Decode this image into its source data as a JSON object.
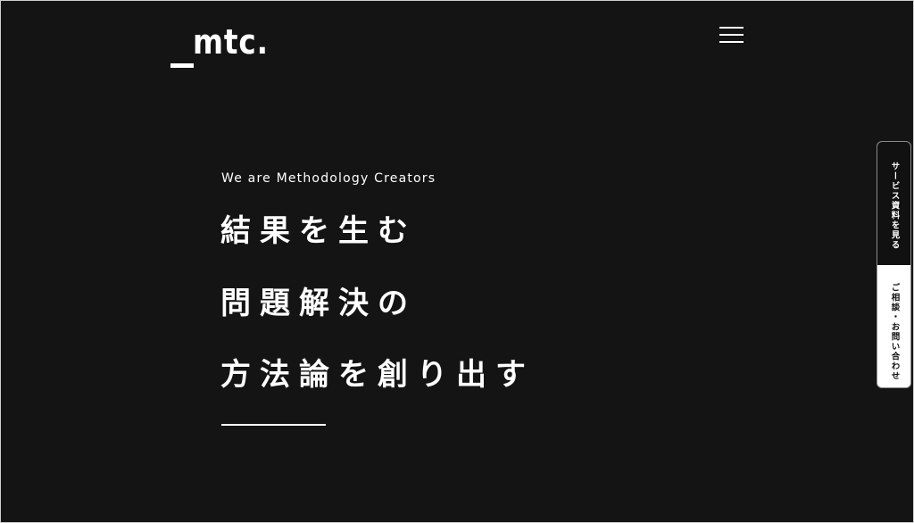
{
  "header": {
    "logo_text": "mtc.",
    "menu_icon": "hamburger-menu-icon"
  },
  "hero": {
    "tagline": "We are Methodology Creators",
    "headline_lines": [
      "結果を生む",
      "問題解決の",
      "方法論を創り出す"
    ]
  },
  "side_tabs": {
    "service_docs_label": "サービス資料を見る",
    "consult_contact_label": "ご相談・お問い合わせ"
  },
  "colors": {
    "background": "#141414",
    "text": "#ffffff",
    "tab_dark": "#111111",
    "tab_light": "#ffffff"
  }
}
